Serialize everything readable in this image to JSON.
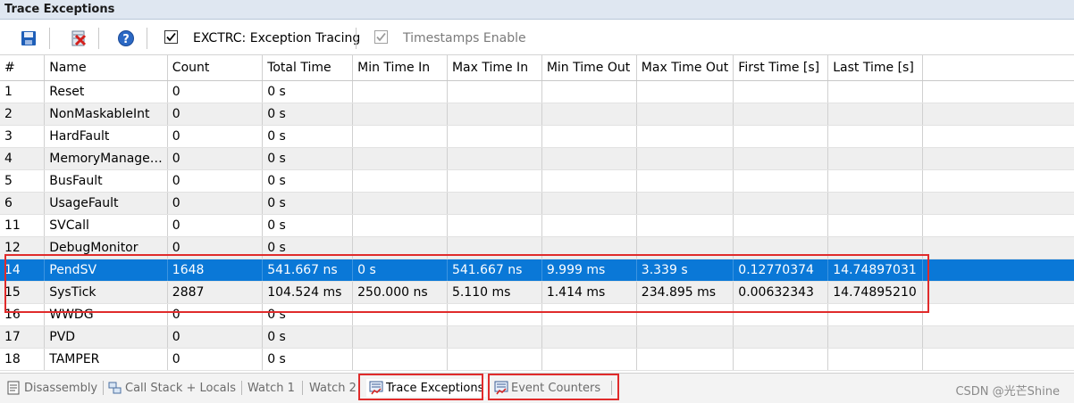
{
  "window": {
    "title": "Trace Exceptions"
  },
  "toolbar": {
    "save_icon": "save-icon",
    "clear_icon": "clear-icon",
    "help_icon": "help-icon",
    "exctrc_label": "EXCTRC: Exception Tracing",
    "exctrc_checked": true,
    "timestamps_label": "Timestamps Enable",
    "timestamps_checked": true,
    "timestamps_disabled": true
  },
  "table": {
    "columns": [
      "#",
      "Name",
      "Count",
      "Total Time",
      "Min Time In",
      "Max Time In",
      "Min Time Out",
      "Max Time Out",
      "First Time [s]",
      "Last Time [s]"
    ],
    "rows": [
      [
        "1",
        "Reset",
        "0",
        "0 s",
        "",
        "",
        "",
        "",
        "",
        ""
      ],
      [
        "2",
        "NonMaskableInt",
        "0",
        "0 s",
        "",
        "",
        "",
        "",
        "",
        ""
      ],
      [
        "3",
        "HardFault",
        "0",
        "0 s",
        "",
        "",
        "",
        "",
        "",
        ""
      ],
      [
        "4",
        "MemoryManage…",
        "0",
        "0 s",
        "",
        "",
        "",
        "",
        "",
        ""
      ],
      [
        "5",
        "BusFault",
        "0",
        "0 s",
        "",
        "",
        "",
        "",
        "",
        ""
      ],
      [
        "6",
        "UsageFault",
        "0",
        "0 s",
        "",
        "",
        "",
        "",
        "",
        ""
      ],
      [
        "11",
        "SVCall",
        "0",
        "0 s",
        "",
        "",
        "",
        "",
        "",
        ""
      ],
      [
        "12",
        "DebugMonitor",
        "0",
        "0 s",
        "",
        "",
        "",
        "",
        "",
        ""
      ],
      [
        "14",
        "PendSV",
        "1648",
        "541.667 ns",
        "0 s",
        "541.667 ns",
        "9.999 ms",
        "3.339 s",
        "0.12770374",
        "14.74897031"
      ],
      [
        "15",
        "SysTick",
        "2887",
        "104.524 ms",
        "250.000 ns",
        "5.110 ms",
        "1.414 ms",
        "234.895 ms",
        "0.00632343",
        "14.74895210"
      ],
      [
        "16",
        "WWDG",
        "0",
        "0 s",
        "",
        "",
        "",
        "",
        "",
        ""
      ],
      [
        "17",
        "PVD",
        "0",
        "0 s",
        "",
        "",
        "",
        "",
        "",
        ""
      ],
      [
        "18",
        "TAMPER",
        "0",
        "0 s",
        "",
        "",
        "",
        "",
        "",
        ""
      ]
    ],
    "selected_row": 8,
    "highlighted_rows": [
      8,
      9
    ],
    "highlight_color": "#e02b2b",
    "selection_color": "#0a78d7"
  },
  "tabs": [
    {
      "label": "Disassembly",
      "icon": "disassembly-icon",
      "active": false
    },
    {
      "label": "Call Stack + Locals",
      "icon": "call-stack-icon",
      "active": false
    },
    {
      "label": "Watch 1",
      "icon": "",
      "active": false
    },
    {
      "label": "Watch 2",
      "icon": "",
      "active": false
    },
    {
      "label": "Trace Exceptions",
      "icon": "trace-exceptions-icon",
      "active": true
    },
    {
      "label": "Event Counters",
      "icon": "event-counters-icon",
      "active": false
    }
  ],
  "watermark": "CSDN @光芒Shine"
}
